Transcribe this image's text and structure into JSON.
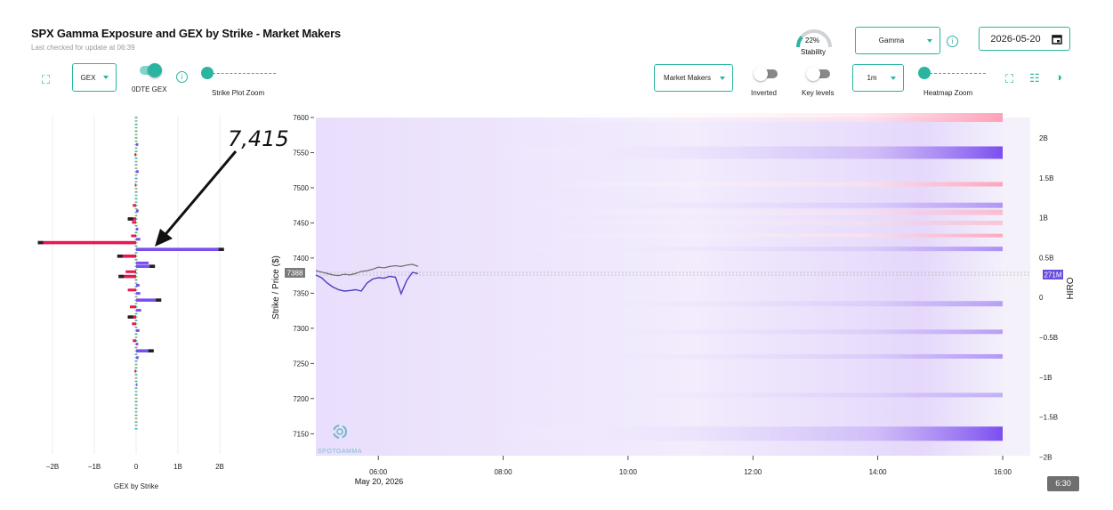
{
  "header": {
    "title": "SPX Gamma Exposure and GEX by Strike - Market Makers",
    "subtitle": "Last checked for update at 06:39"
  },
  "stability": {
    "value": "22%",
    "label": "Stability",
    "fraction": 0.22
  },
  "gamma_select": {
    "value": "Gamma"
  },
  "date_field": {
    "value": "2026-05-20"
  },
  "left_controls": {
    "gex_select": "GEX",
    "zero_dte_label": "0DTE GEX",
    "zero_dte_on": true,
    "strike_zoom_label": "Strike Plot Zoom"
  },
  "right_controls": {
    "market_makers_select": "Market Makers",
    "inverted_label": "Inverted",
    "key_levels_label": "Key levels",
    "interval_select": "1m",
    "heatmap_zoom_label": "Heatmap Zoom"
  },
  "colors": {
    "accent": "#2bb5a0",
    "positive": "#7b4ef0",
    "negative": "#e8184e"
  },
  "icons": [
    "expand-icon",
    "info-icon",
    "calendar-icon",
    "settings-sliders-icon",
    "contrast-icon",
    "spotgamma-logo-icon"
  ],
  "annotation": {
    "text": "7,415"
  },
  "watermark": "SPOTGAMMA",
  "badge": {
    "time": "6:30"
  },
  "chart_data": [
    {
      "type": "bar",
      "title": "",
      "xlabel": "GEX by Strike",
      "x_ticks": [
        "−2B",
        "−1B",
        "0",
        "1B",
        "2B"
      ],
      "xlim": [
        -2400000000,
        2400000000
      ],
      "orientation": "horizontal",
      "notable_bars": [
        {
          "strike": 7415,
          "value": -2350000000
        },
        {
          "strike": 7405,
          "value": 2100000000
        },
        {
          "strike": 7395,
          "value": -450000000
        },
        {
          "strike": 7380,
          "value": 450000000
        },
        {
          "strike": 7365,
          "value": -420000000
        },
        {
          "strike": 7330,
          "value": 600000000
        },
        {
          "strike": 7305,
          "value": -200000000
        },
        {
          "strike": 7255,
          "value": 420000000
        },
        {
          "strike": 7450,
          "value": -200000000
        }
      ]
    },
    {
      "type": "heatmap",
      "ylabel": "Strike / Price ($)",
      "y_ticks": [
        "7600",
        "7550",
        "7500",
        "7450",
        "7400",
        "7350",
        "7300",
        "7250",
        "7200",
        "7150"
      ],
      "x_ticks": [
        "06:00",
        "08:00",
        "10:00",
        "12:00",
        "14:00",
        "16:00"
      ],
      "x_sublabel": "May 20, 2026",
      "price_label": "7388",
      "right_axis_label": "HIRO",
      "right_ticks": [
        "2B",
        "1.5B",
        "1B",
        "0.5B",
        "0",
        "−0.5B",
        "−1B",
        "−1.5B",
        "−2B"
      ],
      "hiro_label": "271M",
      "price_series": [
        7382,
        7380,
        7378,
        7376,
        7375,
        7377,
        7376,
        7378,
        7381,
        7382,
        7384,
        7387,
        7386,
        7388,
        7389,
        7388,
        7390,
        7391,
        7388
      ],
      "hiro_series": [
        0,
        -10,
        -30,
        -45,
        -55,
        -60,
        -58,
        -55,
        -60,
        -30,
        -15,
        -10,
        -12,
        -5,
        -8,
        -70,
        -20,
        10,
        5
      ]
    }
  ]
}
